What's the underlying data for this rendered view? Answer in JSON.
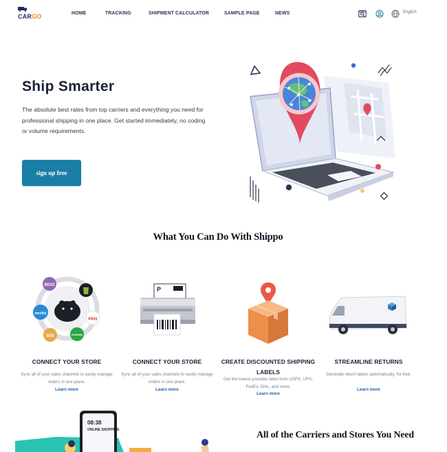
{
  "brand": {
    "logo_prefix": "CAR",
    "logo_suffix": "GO",
    "accent_color": "#e88a1a"
  },
  "nav": {
    "items": [
      {
        "label": "HOME"
      },
      {
        "label": "TRACKING"
      },
      {
        "label": "SHIPMENT CALCULATOR"
      },
      {
        "label": "SAMPLE PAGE"
      },
      {
        "label": "NEWS"
      }
    ],
    "language": "English",
    "icons": [
      "search-image-icon",
      "user-icon",
      "globe-icon"
    ]
  },
  "hero": {
    "title": "Ship Smarter",
    "description": "The absolute best rates from top carriers and everything you need for professional shipping in one place. Get started immediately, no coding or volume requirements.",
    "cta_label": "sign up free",
    "cta_color": "#1a7ea6"
  },
  "section": {
    "title": "What You Can Do With Shippo"
  },
  "features": [
    {
      "title": "CONNECT YOUR STORE",
      "description": "Sync all of your sales channels to easily manage orders in one place.",
      "link": "Learn more",
      "art_labels": {
        "woo": "WOO",
        "weebly": "weebly",
        "wix": "WIX",
        "ebay": "ebay",
        "godaddy": "GoDaddy"
      }
    },
    {
      "title": "CONNECT YOUR STORE",
      "description": "Sync all of your sales channels to easily manage orders in one place.",
      "link": "Learn more",
      "art_labels": {
        "p": "P"
      }
    },
    {
      "title": "CREATE DISCOUNTED SHIPPING LABELS",
      "description": "Get the lowest possible rates from USPS, UPS, FedEx, DHL, and more.",
      "link": "Learn more"
    },
    {
      "title": "STREAMLINE RETURNS",
      "description": "Generate return labels automatically, for free.",
      "link": "Learn more"
    }
  ],
  "bottom": {
    "title": "All of the Carriers and Stores You Need",
    "phone_time": "08:38",
    "phone_label": "ONLINE SHOPPING"
  },
  "colors": {
    "link": "#1f5fa8",
    "heading": "#111520"
  }
}
